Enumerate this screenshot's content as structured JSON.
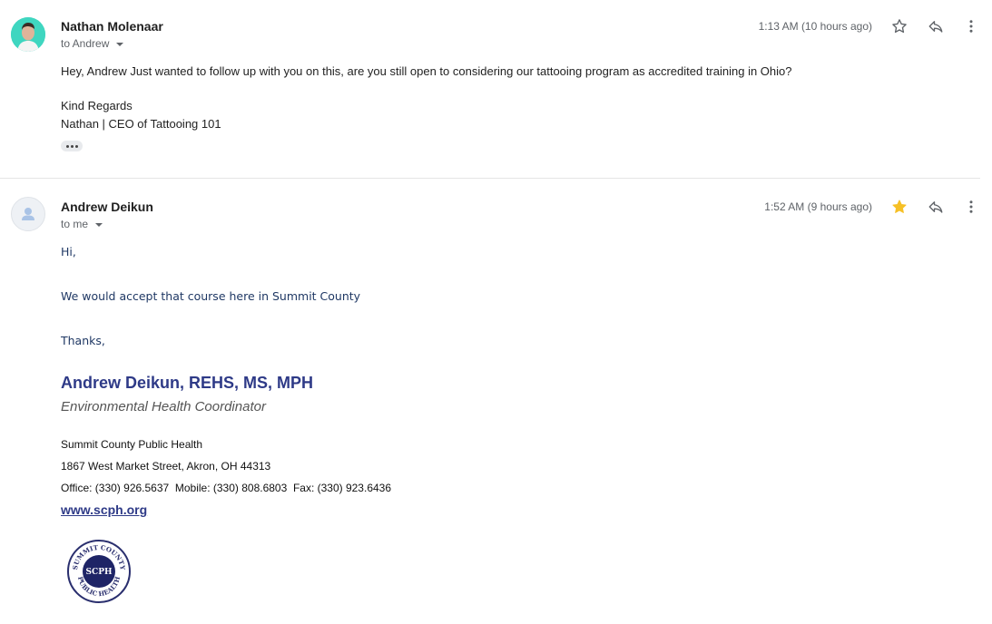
{
  "messages": [
    {
      "sender": "Nathan Molenaar",
      "to": "to Andrew",
      "time": "1:13 AM (10 hours ago)",
      "starred": false,
      "body": [
        "Hey, Andrew Just wanted to follow up with you on this, are you still open to considering our tattooing program as accredited training in Ohio?",
        "Kind Regards",
        "Nathan | CEO of Tattooing 101"
      ]
    },
    {
      "sender": "Andrew Deikun",
      "to": "to me",
      "time": "1:52 AM (9 hours ago)",
      "starred": true,
      "body": [
        "Hi,",
        "We would accept that course here in Summit County",
        "Thanks,"
      ],
      "signature": {
        "name": "Andrew Deikun, REHS, MS, MPH",
        "title": "Environmental Health Coordinator",
        "organization": "Summit County Public Health",
        "address": "1867 West Market Street, Akron, OH 44313",
        "phones": "Office: (330) 926.5637  Mobile: (330) 808.6803  Fax: (330) 923.6436",
        "website": "www.scph.org",
        "logo_text": "SUMMIT COUNTY PUBLIC HEALTH SCPH"
      }
    }
  ],
  "icons": {
    "star": "star-icon",
    "reply": "reply-icon",
    "more": "more-vert-icon",
    "person": "person-icon"
  },
  "colors": {
    "star_filled": "#f6c026",
    "signature_blue": "#2e3a87",
    "body_blue": "#1f3864",
    "secondary_text": "#5f6368"
  }
}
